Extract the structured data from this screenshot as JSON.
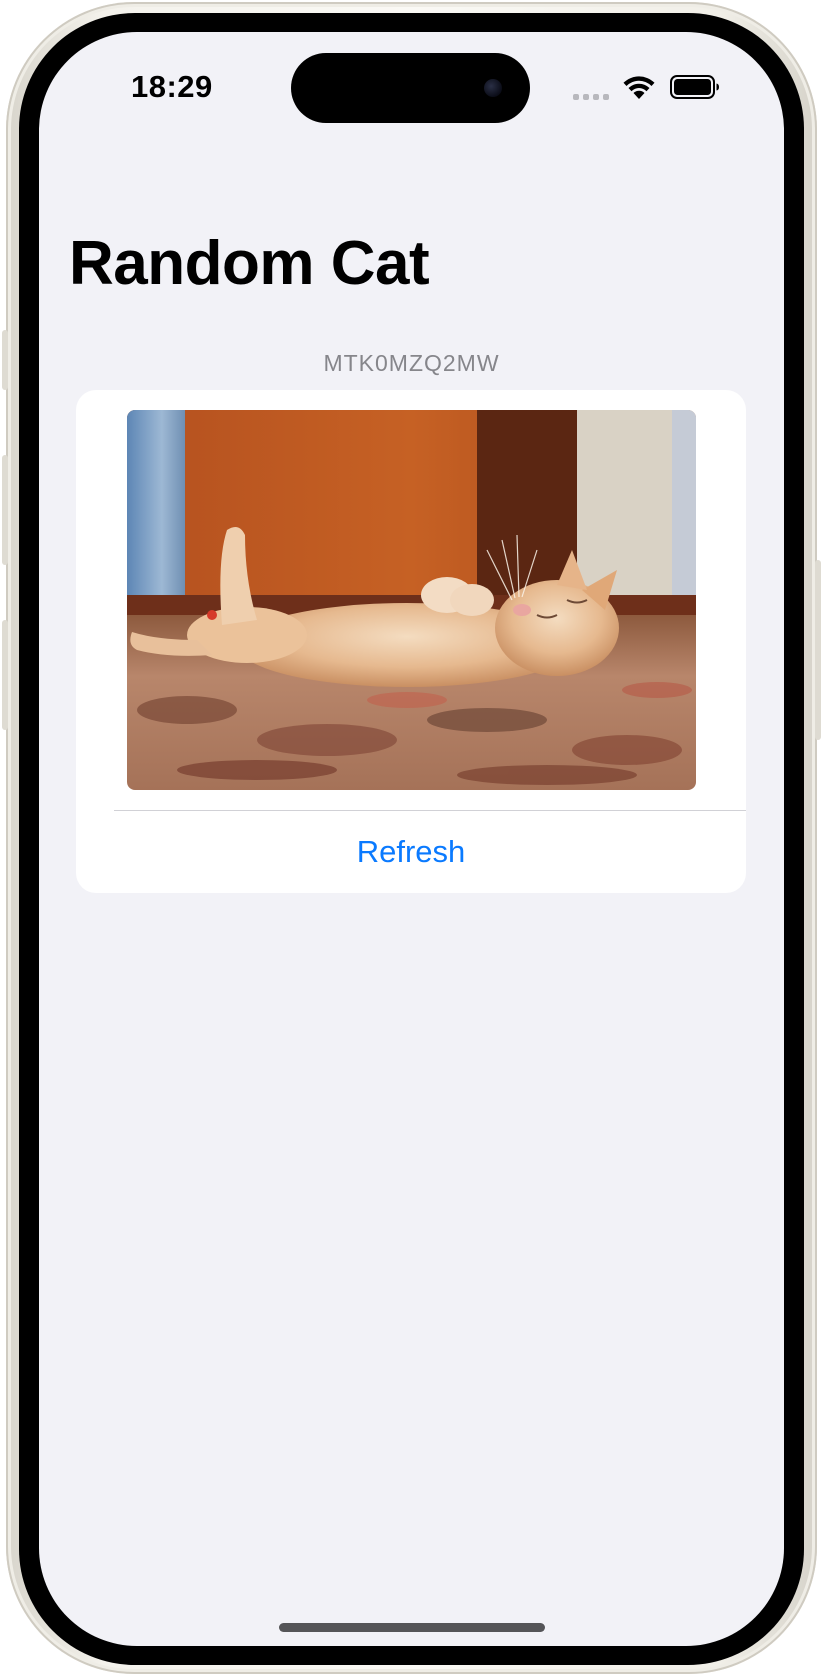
{
  "status_bar": {
    "time": "18:29",
    "signal_icon": "cellular-signal-icon",
    "wifi_icon": "wifi-icon",
    "battery_icon": "battery-icon"
  },
  "navigation": {
    "title": "Random Cat"
  },
  "section": {
    "header": "MTK0MZQ2MW"
  },
  "card": {
    "image_icon": "cat-photo",
    "refresh_label": "Refresh"
  },
  "colors": {
    "background": "#f2f2f7",
    "card": "#ffffff",
    "accent": "#0a7aff",
    "secondary_text": "#86868b"
  }
}
